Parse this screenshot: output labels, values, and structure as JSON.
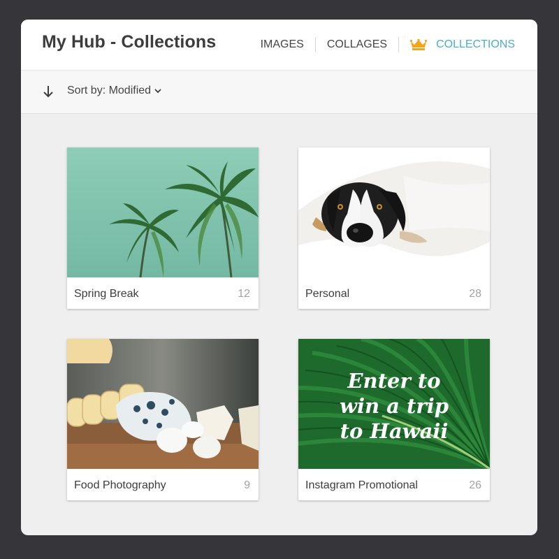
{
  "header": {
    "title": "My Hub - Collections",
    "nav": [
      {
        "label": "IMAGES"
      },
      {
        "label": "COLLAGES"
      },
      {
        "label": "COLLECTIONS",
        "icon": "crown-icon",
        "active": true
      }
    ]
  },
  "toolbar": {
    "sort_direction_icon": "arrow-down-icon",
    "sort_label": "Sort by: Modified"
  },
  "colors": {
    "accent": "#4aaecf",
    "crown": "#f4a51c",
    "title": "#3c3c3c",
    "count": "#a3a3a3"
  },
  "collections": [
    {
      "name": "Spring Break",
      "count": "12"
    },
    {
      "name": "Personal",
      "count": "28"
    },
    {
      "name": "Food Photography",
      "count": "9"
    },
    {
      "name": "Instagram Promotional",
      "count": "26",
      "image_text": [
        "Enter to",
        "win a trip",
        "to Hawaii"
      ]
    }
  ]
}
